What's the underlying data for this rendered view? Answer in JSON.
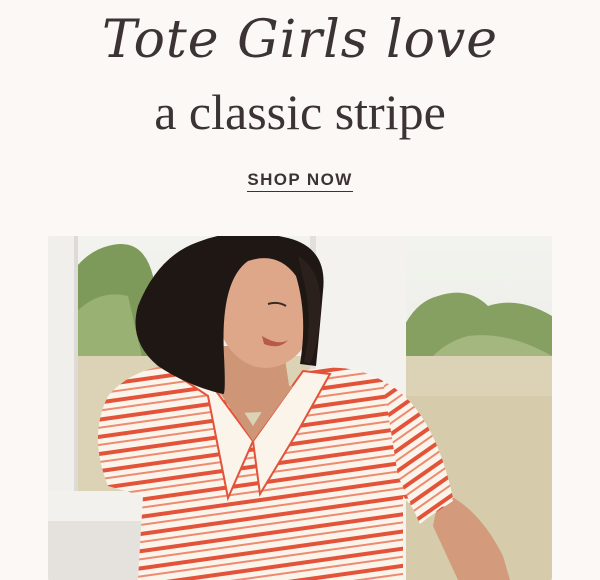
{
  "header": {
    "script_title": "Tote Girls love",
    "title": "a classic stripe",
    "cta_label": "SHOP NOW"
  },
  "hero": {
    "image_description_icon": "woman-in-striped-polo-photo",
    "colors": {
      "sky": "#e9ece6",
      "foliage": "#8fa56a",
      "field": "#d8cfb2",
      "railing": "#f3f1ee",
      "hair": "#1f1714",
      "skin": "#d9a284",
      "shirt": "#fbf4ea",
      "stripe": "#e2533a"
    }
  }
}
